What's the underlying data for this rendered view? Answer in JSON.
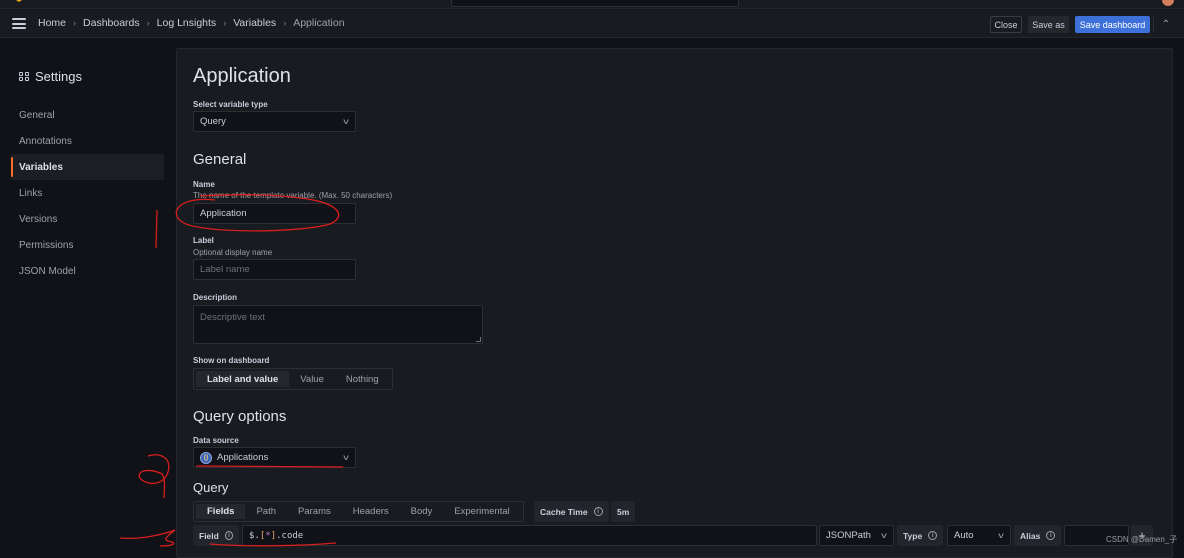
{
  "topbar": {
    "logo_icon": "grafana-logo-icon",
    "search_placeholder": "",
    "avatar_icon": "user-avatar"
  },
  "navbar": {
    "menu_icon": "hamburger-icon",
    "breadcrumb": [
      "Home",
      "Dashboards",
      "Log Lnsights",
      "Variables",
      "Application"
    ],
    "separator": "›",
    "buttons": {
      "close": "Close",
      "save_as": "Save as",
      "save_dashboard": "Save dashboard",
      "collapse": "⌃"
    },
    "colors": {
      "primary": "#3d71d9"
    }
  },
  "sidebar": {
    "title": "Settings",
    "title_icon": "grid-icon",
    "items": [
      {
        "label": "General",
        "active": false
      },
      {
        "label": "Annotations",
        "active": false
      },
      {
        "label": "Variables",
        "active": true
      },
      {
        "label": "Links",
        "active": false
      },
      {
        "label": "Versions",
        "active": false
      },
      {
        "label": "Permissions",
        "active": false
      },
      {
        "label": "JSON Model",
        "active": false
      }
    ],
    "active_color": "#f46e2d"
  },
  "main": {
    "title": "Application",
    "variable_type": {
      "label": "Select variable type",
      "value": "Query"
    },
    "general": {
      "heading": "General",
      "name": {
        "label": "Name",
        "description": "The name of the template variable. (Max. 50 characters)",
        "value": "Application"
      },
      "label": {
        "label": "Label",
        "description": "Optional display name",
        "placeholder": "Label name",
        "value": ""
      },
      "description": {
        "label": "Description",
        "placeholder": "Descriptive text",
        "value": ""
      },
      "show_on_dashboard": {
        "label": "Show on dashboard",
        "options": [
          "Label and value",
          "Value",
          "Nothing"
        ],
        "selected": "Label and value"
      }
    },
    "query_options": {
      "heading": "Query options",
      "data_source": {
        "label": "Data source",
        "value": "Applications",
        "icon": "json-api-datasource-icon"
      },
      "query": {
        "heading": "Query",
        "tabs": [
          "Fields",
          "Path",
          "Params",
          "Headers",
          "Body",
          "Experimental"
        ],
        "active_tab": "Fields",
        "cache_time": {
          "label": "Cache Time",
          "value": "5m"
        },
        "field": {
          "label": "Field",
          "value": "$.[*].code",
          "tokens": [
            "$.",
            "[",
            "*",
            "]",
            ".code"
          ],
          "language": "JSONPath",
          "type_label": "Type",
          "type_value": "Auto",
          "alias_label": "Alias",
          "alias_value": "",
          "add_label": "+"
        }
      }
    }
  },
  "watermark": "CSDN @Damen_子",
  "annotations": {
    "color": "#d81e1e",
    "marks": [
      "circle-around-name",
      "vertical-stroke",
      "number-2",
      "number-3",
      "underline-datasource",
      "underline-field"
    ]
  }
}
